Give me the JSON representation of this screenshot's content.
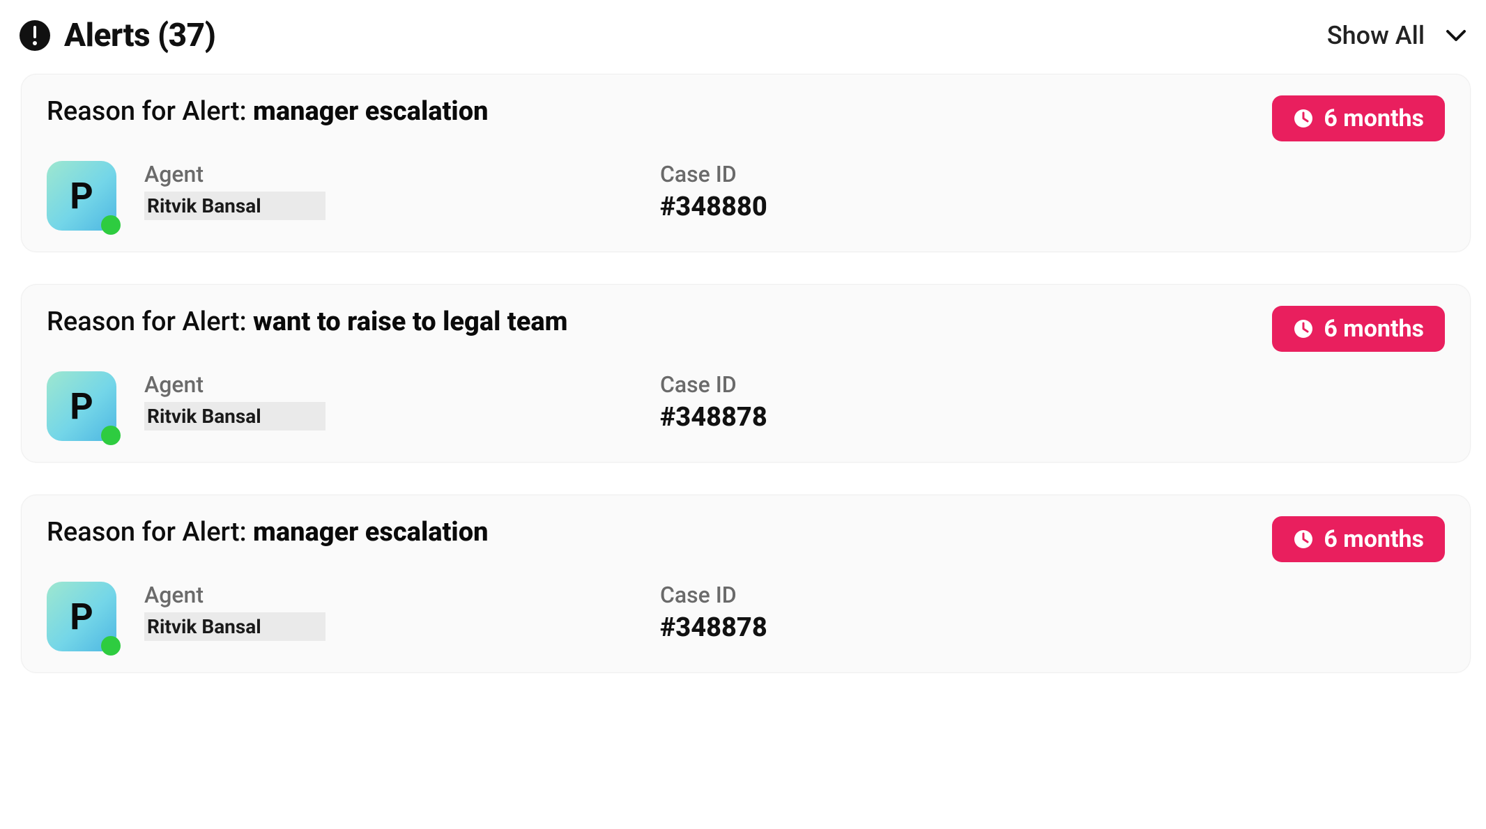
{
  "header": {
    "title": "Alerts (37)",
    "show_all_label": "Show All"
  },
  "labels": {
    "reason_prefix": "Reason for Alert: ",
    "agent": "Agent",
    "case_id": "Case ID"
  },
  "colors": {
    "badge_bg": "#e91f5e",
    "presence_online": "#2ecc40"
  },
  "alerts": [
    {
      "reason": "manager escalation",
      "age_label": "6 months",
      "avatar_initial": "P",
      "agent_name": "Ritvik Bansal",
      "case_id": "#348880",
      "presence": "online"
    },
    {
      "reason": "want to raise to legal team",
      "age_label": "6 months",
      "avatar_initial": "P",
      "agent_name": "Ritvik Bansal",
      "case_id": "#348878",
      "presence": "online"
    },
    {
      "reason": "manager escalation",
      "age_label": "6 months",
      "avatar_initial": "P",
      "agent_name": "Ritvik Bansal",
      "case_id": "#348878",
      "presence": "online"
    }
  ]
}
